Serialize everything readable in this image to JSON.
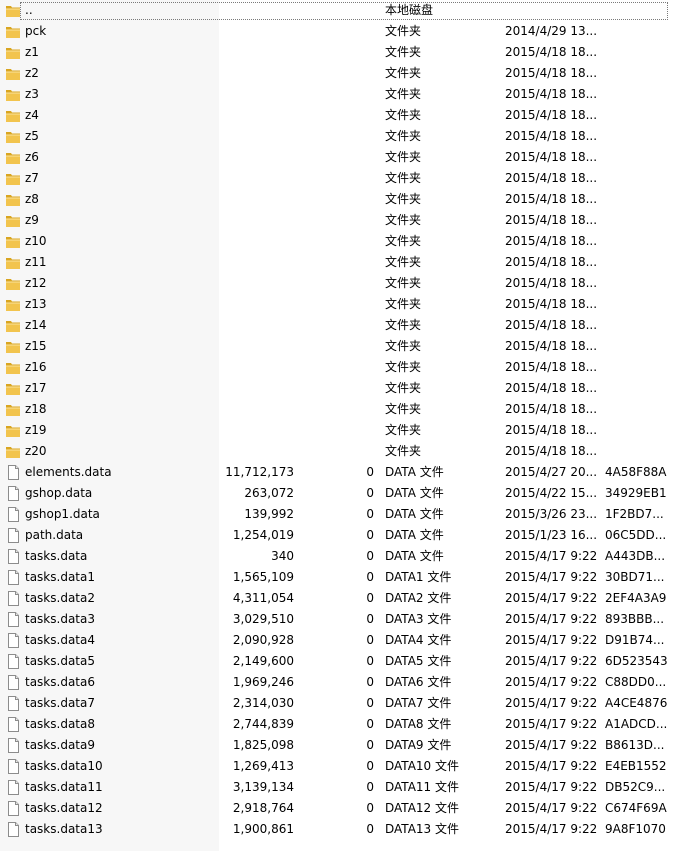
{
  "colors": {
    "folder_body": "#f2c44d",
    "folder_dark": "#d9a520",
    "name_column_bg": "#f7f7f7",
    "focus_border": "#7a7a7a"
  },
  "icons": {
    "folder": "folder-icon",
    "file": "file-icon"
  },
  "rows": [
    {
      "name": "..",
      "size": "",
      "packed": "",
      "type": "本地磁盘",
      "date": "",
      "crc": "",
      "kind": "folder"
    },
    {
      "name": "pck",
      "size": "",
      "packed": "",
      "type": "文件夹",
      "date": "2014/4/29 13...",
      "crc": "",
      "kind": "folder"
    },
    {
      "name": "z1",
      "size": "",
      "packed": "",
      "type": "文件夹",
      "date": "2015/4/18 18...",
      "crc": "",
      "kind": "folder"
    },
    {
      "name": "z2",
      "size": "",
      "packed": "",
      "type": "文件夹",
      "date": "2015/4/18 18...",
      "crc": "",
      "kind": "folder"
    },
    {
      "name": "z3",
      "size": "",
      "packed": "",
      "type": "文件夹",
      "date": "2015/4/18 18...",
      "crc": "",
      "kind": "folder"
    },
    {
      "name": "z4",
      "size": "",
      "packed": "",
      "type": "文件夹",
      "date": "2015/4/18 18...",
      "crc": "",
      "kind": "folder"
    },
    {
      "name": "z5",
      "size": "",
      "packed": "",
      "type": "文件夹",
      "date": "2015/4/18 18...",
      "crc": "",
      "kind": "folder"
    },
    {
      "name": "z6",
      "size": "",
      "packed": "",
      "type": "文件夹",
      "date": "2015/4/18 18...",
      "crc": "",
      "kind": "folder"
    },
    {
      "name": "z7",
      "size": "",
      "packed": "",
      "type": "文件夹",
      "date": "2015/4/18 18...",
      "crc": "",
      "kind": "folder"
    },
    {
      "name": "z8",
      "size": "",
      "packed": "",
      "type": "文件夹",
      "date": "2015/4/18 18...",
      "crc": "",
      "kind": "folder"
    },
    {
      "name": "z9",
      "size": "",
      "packed": "",
      "type": "文件夹",
      "date": "2015/4/18 18...",
      "crc": "",
      "kind": "folder"
    },
    {
      "name": "z10",
      "size": "",
      "packed": "",
      "type": "文件夹",
      "date": "2015/4/18 18...",
      "crc": "",
      "kind": "folder"
    },
    {
      "name": "z11",
      "size": "",
      "packed": "",
      "type": "文件夹",
      "date": "2015/4/18 18...",
      "crc": "",
      "kind": "folder"
    },
    {
      "name": "z12",
      "size": "",
      "packed": "",
      "type": "文件夹",
      "date": "2015/4/18 18...",
      "crc": "",
      "kind": "folder"
    },
    {
      "name": "z13",
      "size": "",
      "packed": "",
      "type": "文件夹",
      "date": "2015/4/18 18...",
      "crc": "",
      "kind": "folder"
    },
    {
      "name": "z14",
      "size": "",
      "packed": "",
      "type": "文件夹",
      "date": "2015/4/18 18...",
      "crc": "",
      "kind": "folder"
    },
    {
      "name": "z15",
      "size": "",
      "packed": "",
      "type": "文件夹",
      "date": "2015/4/18 18...",
      "crc": "",
      "kind": "folder"
    },
    {
      "name": "z16",
      "size": "",
      "packed": "",
      "type": "文件夹",
      "date": "2015/4/18 18...",
      "crc": "",
      "kind": "folder"
    },
    {
      "name": "z17",
      "size": "",
      "packed": "",
      "type": "文件夹",
      "date": "2015/4/18 18...",
      "crc": "",
      "kind": "folder"
    },
    {
      "name": "z18",
      "size": "",
      "packed": "",
      "type": "文件夹",
      "date": "2015/4/18 18...",
      "crc": "",
      "kind": "folder"
    },
    {
      "name": "z19",
      "size": "",
      "packed": "",
      "type": "文件夹",
      "date": "2015/4/18 18...",
      "crc": "",
      "kind": "folder"
    },
    {
      "name": "z20",
      "size": "",
      "packed": "",
      "type": "文件夹",
      "date": "2015/4/18 18...",
      "crc": "",
      "kind": "folder"
    },
    {
      "name": "elements.data",
      "size": "11,712,173",
      "packed": "0",
      "type": "DATA 文件",
      "date": "2015/4/27 20...",
      "crc": "4A58F88A",
      "kind": "file"
    },
    {
      "name": "gshop.data",
      "size": "263,072",
      "packed": "0",
      "type": "DATA 文件",
      "date": "2015/4/22 15...",
      "crc": "34929EB1",
      "kind": "file"
    },
    {
      "name": "gshop1.data",
      "size": "139,992",
      "packed": "0",
      "type": "DATA 文件",
      "date": "2015/3/26 23...",
      "crc": "1F2BD7...",
      "kind": "file"
    },
    {
      "name": "path.data",
      "size": "1,254,019",
      "packed": "0",
      "type": "DATA 文件",
      "date": "2015/1/23 16...",
      "crc": "06C5DD...",
      "kind": "file"
    },
    {
      "name": "tasks.data",
      "size": "340",
      "packed": "0",
      "type": "DATA 文件",
      "date": "2015/4/17 9:22",
      "crc": "A443DB...",
      "kind": "file"
    },
    {
      "name": "tasks.data1",
      "size": "1,565,109",
      "packed": "0",
      "type": "DATA1 文件",
      "date": "2015/4/17 9:22",
      "crc": "30BD71...",
      "kind": "file"
    },
    {
      "name": "tasks.data2",
      "size": "4,311,054",
      "packed": "0",
      "type": "DATA2 文件",
      "date": "2015/4/17 9:22",
      "crc": "2EF4A3A9",
      "kind": "file"
    },
    {
      "name": "tasks.data3",
      "size": "3,029,510",
      "packed": "0",
      "type": "DATA3 文件",
      "date": "2015/4/17 9:22",
      "crc": "893BBB...",
      "kind": "file"
    },
    {
      "name": "tasks.data4",
      "size": "2,090,928",
      "packed": "0",
      "type": "DATA4 文件",
      "date": "2015/4/17 9:22",
      "crc": "D91B74...",
      "kind": "file"
    },
    {
      "name": "tasks.data5",
      "size": "2,149,600",
      "packed": "0",
      "type": "DATA5 文件",
      "date": "2015/4/17 9:22",
      "crc": "6D523543",
      "kind": "file"
    },
    {
      "name": "tasks.data6",
      "size": "1,969,246",
      "packed": "0",
      "type": "DATA6 文件",
      "date": "2015/4/17 9:22",
      "crc": "C88DD0...",
      "kind": "file"
    },
    {
      "name": "tasks.data7",
      "size": "2,314,030",
      "packed": "0",
      "type": "DATA7 文件",
      "date": "2015/4/17 9:22",
      "crc": "A4CE4876",
      "kind": "file"
    },
    {
      "name": "tasks.data8",
      "size": "2,744,839",
      "packed": "0",
      "type": "DATA8 文件",
      "date": "2015/4/17 9:22",
      "crc": "A1ADCD...",
      "kind": "file"
    },
    {
      "name": "tasks.data9",
      "size": "1,825,098",
      "packed": "0",
      "type": "DATA9 文件",
      "date": "2015/4/17 9:22",
      "crc": "B8613D...",
      "kind": "file"
    },
    {
      "name": "tasks.data10",
      "size": "1,269,413",
      "packed": "0",
      "type": "DATA10 文件",
      "date": "2015/4/17 9:22",
      "crc": "E4EB1552",
      "kind": "file"
    },
    {
      "name": "tasks.data11",
      "size": "3,139,134",
      "packed": "0",
      "type": "DATA11 文件",
      "date": "2015/4/17 9:22",
      "crc": "DB52C9...",
      "kind": "file"
    },
    {
      "name": "tasks.data12",
      "size": "2,918,764",
      "packed": "0",
      "type": "DATA12 文件",
      "date": "2015/4/17 9:22",
      "crc": "C674F69A",
      "kind": "file"
    },
    {
      "name": "tasks.data13",
      "size": "1,900,861",
      "packed": "0",
      "type": "DATA13 文件",
      "date": "2015/4/17 9:22",
      "crc": "9A8F1070",
      "kind": "file"
    }
  ]
}
